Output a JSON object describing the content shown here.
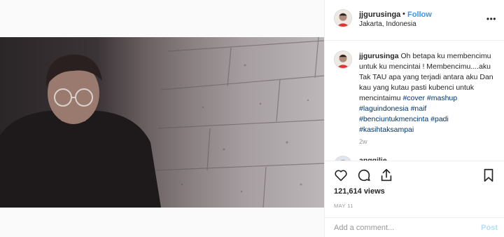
{
  "post": {
    "username": "jjgurusinga",
    "dot": "•",
    "follow_label": "Follow",
    "location": "Jakarta, Indonesia",
    "more_icon": "more-dots-icon"
  },
  "caption": {
    "username": "jjgurusinga",
    "text": "Oh betapa ku membencimu untuk ku mencintai ! Membencimu....aku Tak TAU apa yang terjadi antara aku Dan kau yang kutau pasti kubenci untuk mencintaimu",
    "hashtags": [
      "#cover",
      "#mashup",
      "#laguindonesia",
      "#naif",
      "#benciuntukmencinta",
      "#padi",
      "#kasihtaksampai"
    ],
    "age": "2w"
  },
  "next_comment": {
    "username": "anggilie"
  },
  "actions": {
    "like_icon": "heart-icon",
    "comment_icon": "comment-icon",
    "share_icon": "share-icon",
    "save_icon": "bookmark-icon"
  },
  "stats": {
    "views": "121,614 views",
    "date": "MAY 11"
  },
  "add_comment": {
    "placeholder": "Add a comment...",
    "post_label": "Post"
  },
  "colors": {
    "link": "#3897f0",
    "hashtag": "#003569",
    "post_disabled": "#b2dffc"
  }
}
